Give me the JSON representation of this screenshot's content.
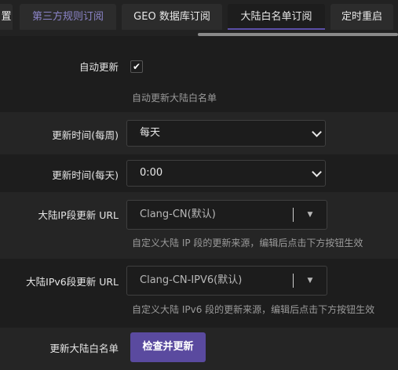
{
  "tabs": [
    {
      "label": "置"
    },
    {
      "label": "第三方规则订阅"
    },
    {
      "label": "GEO 数据库订阅"
    },
    {
      "label": "大陆白名单订阅"
    },
    {
      "label": "定时重启"
    }
  ],
  "form": {
    "auto_update": {
      "label": "自动更新",
      "checked": true,
      "check_glyph": "✔",
      "hint": "自动更新大陆白名单"
    },
    "update_week": {
      "label": "更新时间(每周)",
      "value": "每天"
    },
    "update_day": {
      "label": "更新时间(每天)",
      "value": "0:00"
    },
    "ip_url": {
      "label": "大陆IP段更新 URL",
      "value": "Clang-CN(默认)",
      "arrow": "▼",
      "hint": "自定义大陆 IP 段的更新来源，编辑后点击下方按钮生效"
    },
    "ipv6_url": {
      "label": "大陆IPv6段更新 URL",
      "value": "Clang-CN-IPV6(默认)",
      "arrow": "▼",
      "hint": "自定义大陆 IPv6 段的更新来源，编辑后点击下方按钮生效"
    },
    "update_now": {
      "label": "更新大陆白名单",
      "button": "检查并更新"
    }
  }
}
